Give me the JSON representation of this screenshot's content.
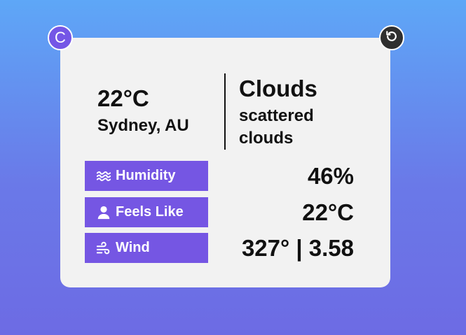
{
  "theme": {
    "accent": "#7556e3",
    "card_background": "#f2f2f2",
    "dark_button": "#2f2f2f"
  },
  "controls": {
    "unit_toggle_label": "C",
    "refresh_icon": "refresh-icon"
  },
  "weather": {
    "temperature": "22°C",
    "location": "Sydney, AU",
    "condition": "Clouds",
    "description": "scattered clouds"
  },
  "details": [
    {
      "icon": "water-waves-icon",
      "label": "Humidity",
      "value": "46%"
    },
    {
      "icon": "person-icon",
      "label": "Feels Like",
      "value": "22°C"
    },
    {
      "icon": "wind-icon",
      "label": "Wind",
      "value": "327° | 3.58"
    }
  ]
}
